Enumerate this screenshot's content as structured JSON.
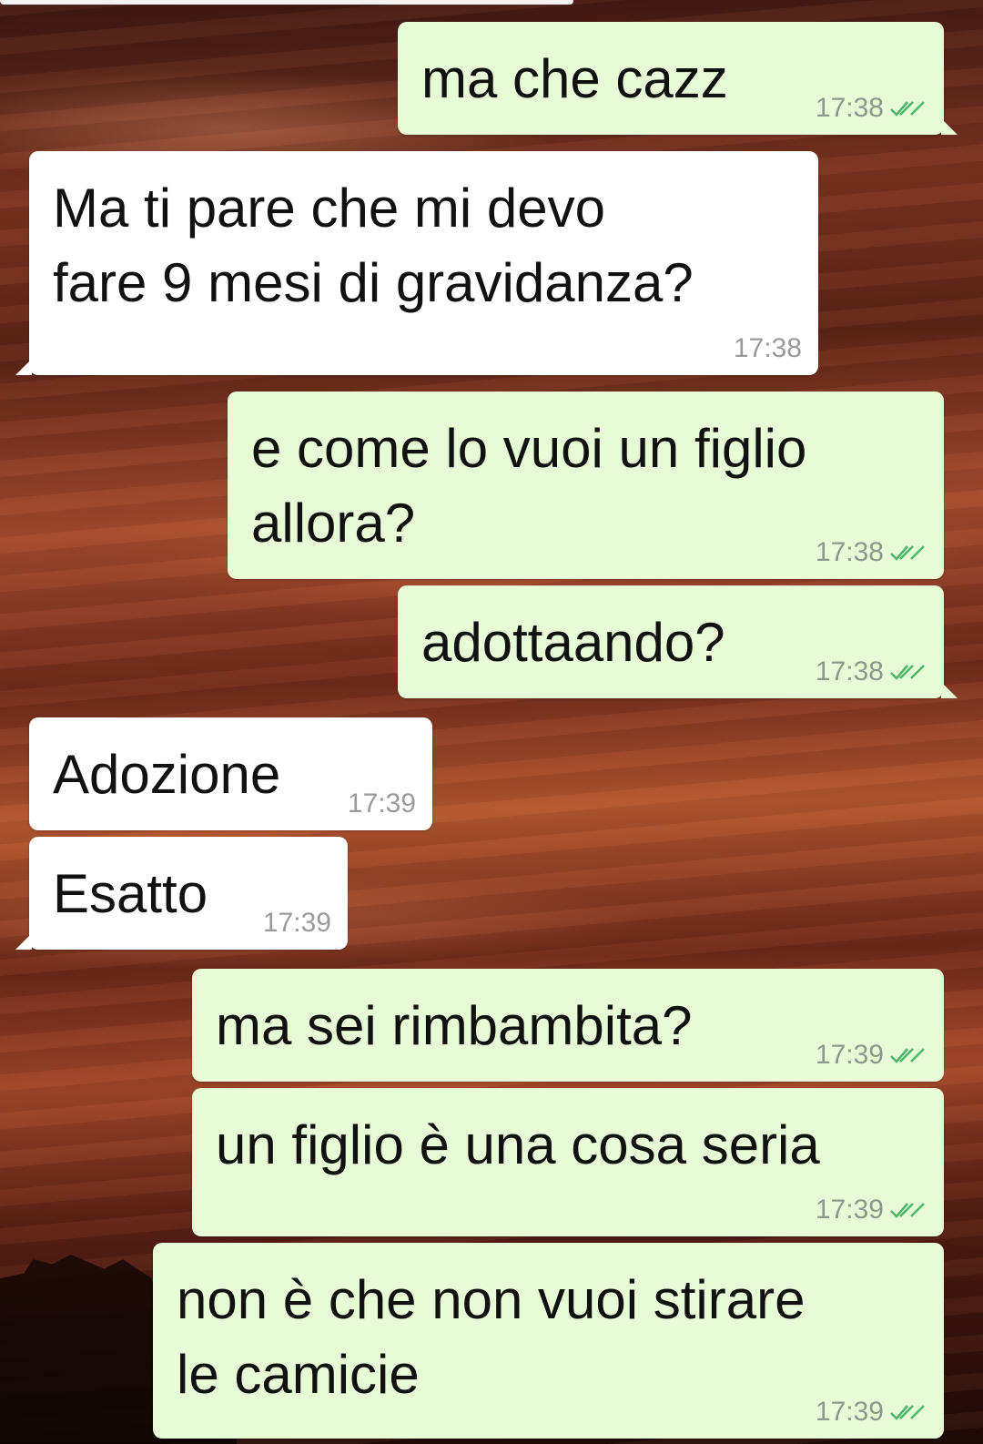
{
  "colors": {
    "outgoing_bubble": "#e7fbd7",
    "incoming_bubble": "#ffffff",
    "read_check": "#4fb76b"
  },
  "messages": [
    {
      "direction": "out",
      "text": "ma che cazz",
      "time": "17:38",
      "status_icon": "double-check-icon"
    },
    {
      "direction": "in",
      "text": "Ma ti pare che mi devo\nfare 9 mesi di gravidanza?",
      "time": "17:38"
    },
    {
      "direction": "out",
      "text": "e come lo vuoi un figlio\nallora?",
      "time": "17:38",
      "status_icon": "double-check-icon"
    },
    {
      "direction": "out",
      "text": "adottaando?",
      "time": "17:38",
      "status_icon": "double-check-icon"
    },
    {
      "direction": "in",
      "text": "Adozione",
      "time": "17:39"
    },
    {
      "direction": "in",
      "text": "Esatto",
      "time": "17:39"
    },
    {
      "direction": "out",
      "text": "ma sei rimbambita?",
      "time": "17:39",
      "status_icon": "double-check-icon"
    },
    {
      "direction": "out",
      "text": "un figlio è una cosa seria",
      "time": "17:39",
      "status_icon": "double-check-icon"
    },
    {
      "direction": "out",
      "text": "non è che non vuoi stirare\nle camicie",
      "time": "17:39",
      "status_icon": "double-check-icon"
    }
  ]
}
